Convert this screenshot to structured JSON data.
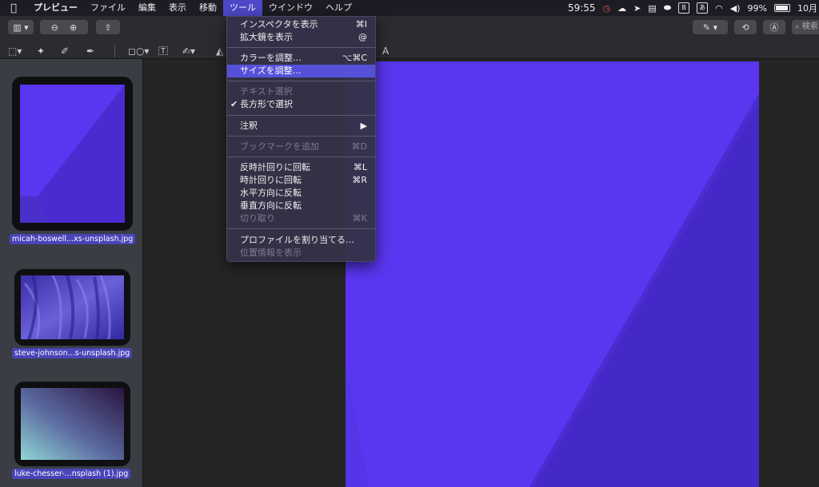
{
  "menubar": {
    "app_name": "プレビュー",
    "items": [
      "ファイル",
      "編集",
      "表示",
      "移動",
      "ツール",
      "ウインドウ",
      "ヘルプ"
    ],
    "active_index": 4,
    "status": {
      "time_remaining": "59:55",
      "battery_percent": "99%",
      "date_partial": "10月",
      "ime_label": "あ"
    }
  },
  "toolbar": {
    "search_placeholder": "検索"
  },
  "sidebar": {
    "thumbnails": [
      {
        "filename": "micah-boswell...xs-unsplash.jpg"
      },
      {
        "filename": "steve-johnson...s-unsplash.jpg"
      },
      {
        "filename": "luke-chesser-...nsplash (1).jpg"
      }
    ]
  },
  "tool_menu": {
    "items": [
      {
        "label": "インスペクタを表示",
        "shortcut": "⌘I",
        "enabled": true
      },
      {
        "label": "拡大鏡を表示",
        "shortcut": "@",
        "enabled": true
      },
      {
        "label": "カラーを調整…",
        "shortcut": "⌥⌘C",
        "enabled": true
      },
      {
        "label": "サイズを調整…",
        "shortcut": "",
        "enabled": true,
        "highlighted": true
      },
      {
        "label": "テキスト選択",
        "shortcut": "",
        "enabled": false
      },
      {
        "label": "長方形で選択",
        "shortcut": "",
        "enabled": true,
        "checked": true
      },
      {
        "label": "注釈",
        "shortcut": "▶",
        "enabled": true
      },
      {
        "label": "ブックマークを追加",
        "shortcut": "⌘D",
        "enabled": false
      },
      {
        "label": "反時計回りに回転",
        "shortcut": "⌘L",
        "enabled": true
      },
      {
        "label": "時計回りに回転",
        "shortcut": "⌘R",
        "enabled": true
      },
      {
        "label": "水平方向に反転",
        "shortcut": "",
        "enabled": true
      },
      {
        "label": "垂直方向に反転",
        "shortcut": "",
        "enabled": true
      },
      {
        "label": "切り取り",
        "shortcut": "⌘K",
        "enabled": false
      },
      {
        "label": "プロファイルを割り当てる…",
        "shortcut": "",
        "enabled": true
      },
      {
        "label": "位置情報を表示",
        "shortcut": "",
        "enabled": false
      }
    ]
  },
  "colors": {
    "accent": "#5551d9",
    "image_purple_light": "#5a36f0",
    "image_purple_dark": "#4528c8"
  }
}
